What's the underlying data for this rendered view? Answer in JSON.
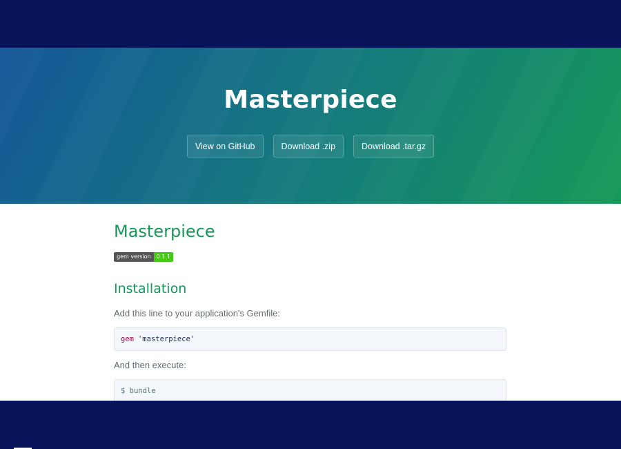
{
  "header": {
    "project_name": "Masterpiece",
    "buttons": [
      "View on GitHub",
      "Download .zip",
      "Download .tar.gz"
    ]
  },
  "main": {
    "title": "Masterpiece",
    "badge": {
      "label": "gem version",
      "value": "0.1.1"
    },
    "installation_heading": "Installation",
    "gemfile_instruction": "Add this line to your application's Gemfile:",
    "gemfile_code": {
      "keyword": "gem",
      "string": "'masterpiece'"
    },
    "execute_instruction": "And then execute:",
    "bundle_code": "$ bundle"
  },
  "colors": {
    "accent": "#159957",
    "hero_start": "#155799",
    "hero_end": "#159957",
    "frame": "#08145a"
  }
}
